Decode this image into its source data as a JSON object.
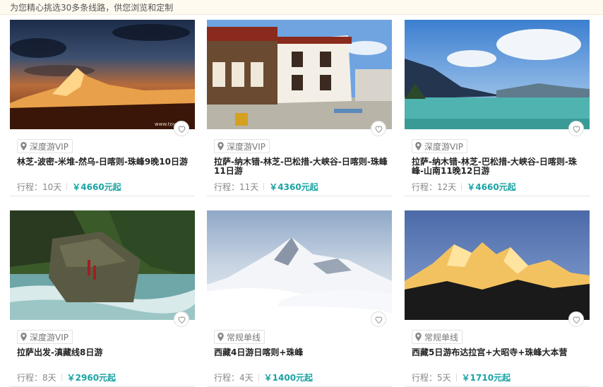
{
  "intro": "为您精心挑选30多条线路，供您浏览和定制",
  "accent_color": "#1aa3a3",
  "cards": [
    {
      "scene": "sunset-snow-mountain",
      "watermark": "www.toy...",
      "tag": "深度游VIP",
      "title": "林芝-波密-米堆-然乌-日喀则-珠峰9晚10日游",
      "duration_label": "行程：10天",
      "price": "￥4660元起"
    },
    {
      "scene": "jokhang-temple",
      "tag": "深度游VIP",
      "title": "拉萨-纳木错-林芝-巴松措-大峡谷-日喀则-珠峰11日游",
      "duration_label": "行程：11天",
      "price": "￥4360元起"
    },
    {
      "scene": "turquoise-lake",
      "tag": "深度游VIP",
      "title": "拉萨-纳木错-林芝-巴松措-大峡谷-日喀则-珠峰-山南11晚12日游",
      "duration_label": "行程：12天",
      "price": "￥4660元起"
    },
    {
      "scene": "river-rock",
      "tag": "深度游VIP",
      "title": "拉萨出发-滇藏线8日游",
      "duration_label": "行程：8天",
      "price": "￥2960元起"
    },
    {
      "scene": "everest-clouds",
      "tag": "常规单线",
      "title": "西藏4日游日喀则+珠峰",
      "duration_label": "行程：4天",
      "price": "￥1400元起"
    },
    {
      "scene": "golden-peaks",
      "tag": "常规单线",
      "title": "西藏5日游布达拉宫+大昭寺+珠峰大本营",
      "duration_label": "行程：5天",
      "price": "￥1710元起"
    }
  ]
}
